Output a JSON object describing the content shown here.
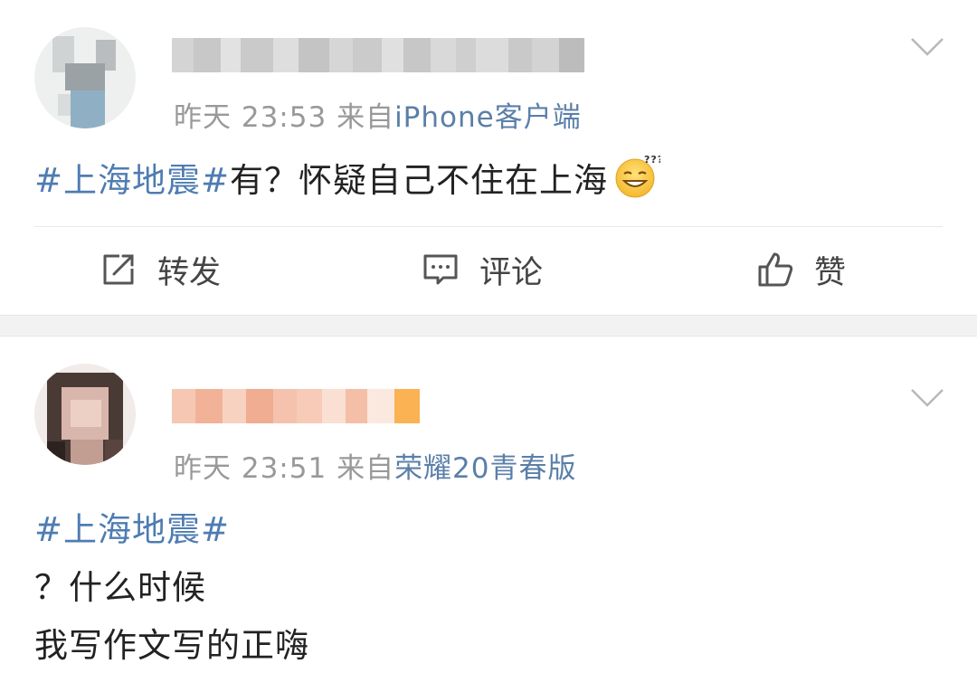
{
  "posts": [
    {
      "time": "昨天 23:53",
      "from_prefix": "来自",
      "source": "iPhone客户端",
      "hashtag": "#上海地震#",
      "text": "有？怀疑自己不住在上海",
      "emoji": "thinking-grin-emoji",
      "actions": {
        "repost": "转发",
        "comment": "评论",
        "like": "赞"
      }
    },
    {
      "time": "昨天 23:51",
      "from_prefix": "来自",
      "source": "荣耀20青春版",
      "hashtag": "#上海地震#",
      "lines": [
        "？什么时候",
        "我写作文写的正嗨"
      ]
    }
  ],
  "colors": {
    "link_blue": "#4e7cb2",
    "meta_gray": "#999999",
    "separator": "#f2f2f2"
  }
}
